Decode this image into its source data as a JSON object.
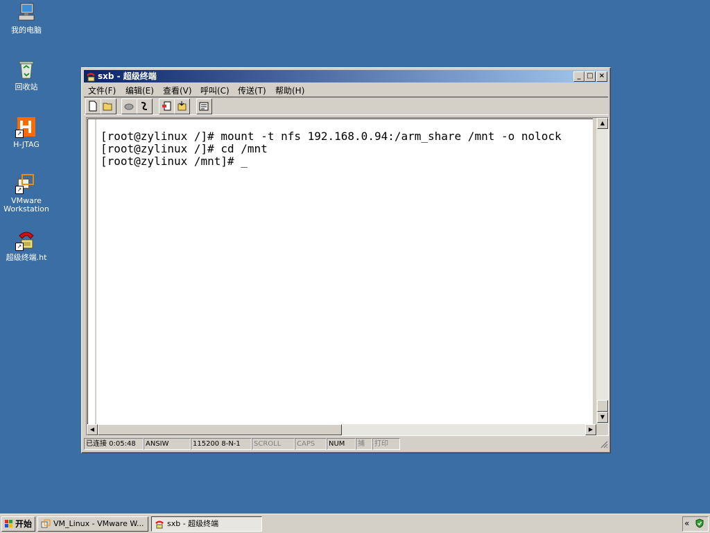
{
  "desktop": {
    "icons": [
      {
        "label": "我的电脑",
        "icon": "my-computer-icon"
      },
      {
        "label": "回收站",
        "icon": "recycle-bin-icon"
      },
      {
        "label": "H-JTAG",
        "icon": "h-jtag-icon"
      },
      {
        "label": "VMware\nWorkstation",
        "icon": "vmware-icon"
      },
      {
        "label": "超级终端.ht",
        "icon": "hyperterminal-phone-icon"
      }
    ]
  },
  "window": {
    "title": "sxb - 超级终端",
    "controls": {
      "minimize": "_",
      "maximize": "□",
      "close": "×"
    },
    "menu": [
      "文件(F)",
      "编辑(E)",
      "查看(V)",
      "呼叫(C)",
      "传送(T)",
      "帮助(H)"
    ],
    "toolbar": [
      {
        "icon": "new-file-icon"
      },
      {
        "icon": "open-folder-icon"
      },
      {
        "icon": "call-icon"
      },
      {
        "icon": "disconnect-icon"
      },
      {
        "icon": "send-icon"
      },
      {
        "icon": "receive-icon"
      },
      {
        "icon": "properties-icon"
      }
    ],
    "terminal": {
      "lines": "[root@zylinux /]# mount -t nfs 192.168.0.94:/arm_share /mnt -o nolock\n[root@zylinux /]# cd /mnt\n[root@zylinux /mnt]# _"
    },
    "status": {
      "connected": "已连接 0:05:48",
      "emulation": "ANSIW",
      "port_settings": "115200 8-N-1",
      "scroll": "SCROLL",
      "caps": "CAPS",
      "num": "NUM",
      "capture": "捕",
      "print": "打印"
    }
  },
  "taskbar": {
    "start": "开始",
    "tasks": [
      {
        "label": "VM_Linux - VMware W...",
        "active": false
      },
      {
        "label": "sxb - 超级终端",
        "active": true
      }
    ],
    "tray": {
      "expand": "«"
    }
  },
  "colors": {
    "desktop": "#3a6ea5",
    "title_start": "#0a246a",
    "title_end": "#a6caf0",
    "face": "#d4d0c8"
  }
}
